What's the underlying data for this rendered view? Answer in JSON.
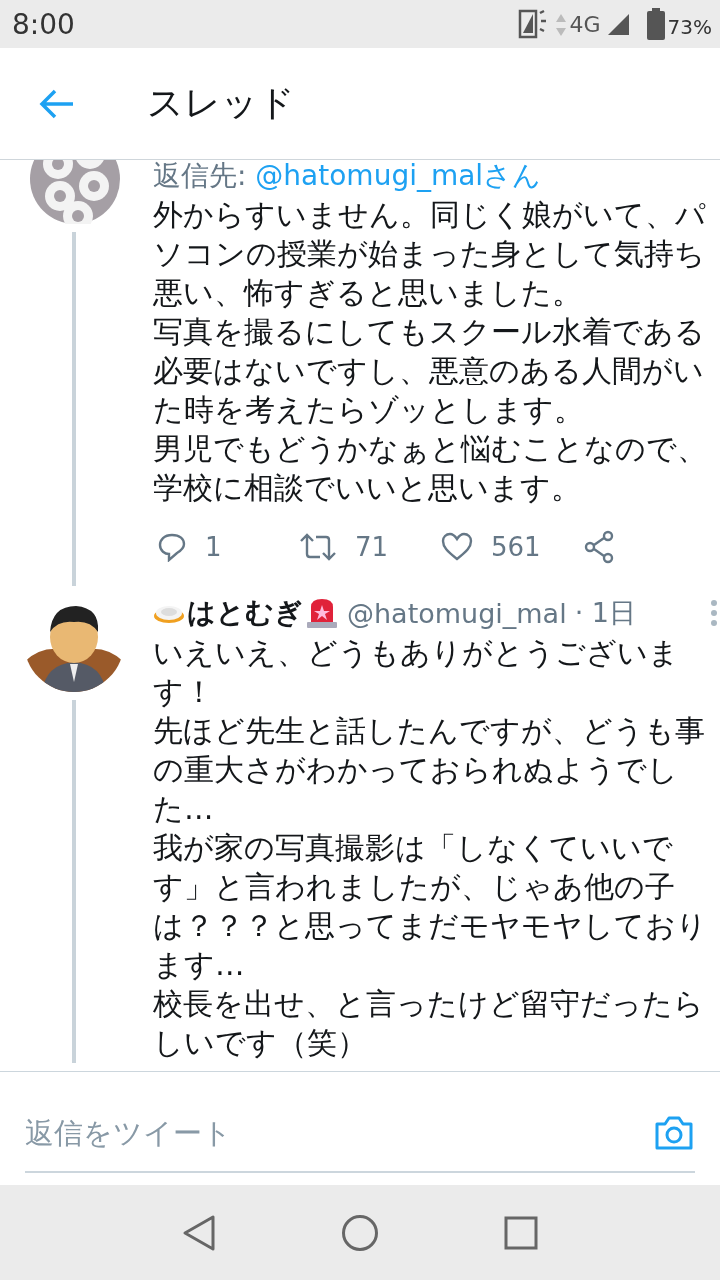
{
  "status_bar": {
    "time": "8:00",
    "network": "4G",
    "battery": "73%"
  },
  "header": {
    "title": "スレッド"
  },
  "tweets": [
    {
      "reply_to_label": "返信先:",
      "reply_to_handle": "@hatomugi_malさん",
      "paragraphs": [
        "外からすいません。同じく娘がいて、パソコンの授業が始まった身として気持ち悪い、怖すぎると思いました。",
        "写真を撮るにしてもスクール水着である必要はないですし、悪意のある人間がいた時を考えたらゾッとします。",
        "男児でもどうかなぁと悩むことなので、学校に相談でいいと思います。"
      ],
      "actions": {
        "replies": "1",
        "retweets": "71",
        "likes": "561"
      }
    },
    {
      "name": "はとむぎ",
      "handle": "@hatomugi_mal",
      "time": "· 1日",
      "paragraphs": [
        "いえいえ、どうもありがとうございます！",
        "先ほど先生と話したんですが、どうも事の重大さがわかっておられぬようでした…",
        "我が家の写真撮影は「しなくていいです」と言われましたが、じゃあ他の子は？？？と思ってまだモヤモヤしております…",
        "校長を出せ、と言ったけど留守だったらしいです（笑）"
      ]
    }
  ],
  "reply_bar": {
    "placeholder": "返信をツイート"
  }
}
